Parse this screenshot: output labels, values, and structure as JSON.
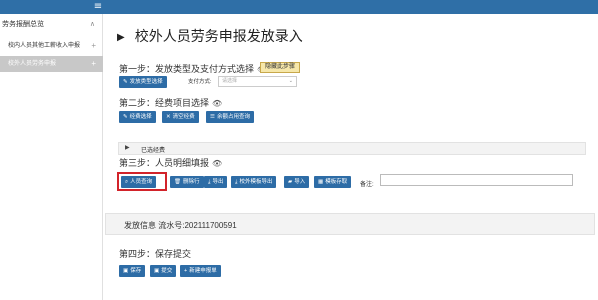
{
  "topbar": {
    "menu_icon": "hamburger-icon"
  },
  "sidebar": {
    "header": "劳务报酬总览",
    "items": [
      {
        "label": "校内人员其他工薪收入申报",
        "active": false
      },
      {
        "label": "校外人员劳务申报",
        "active": true
      }
    ]
  },
  "page": {
    "title": "校外人员劳务申报发放录入"
  },
  "step1": {
    "title": "第一步：发放类型及支付方式选择",
    "hide_label": "隐藏此步骤",
    "type_button": "发放类型选择",
    "pay_label": "支付方式:",
    "pay_placeholder": "请选择"
  },
  "step2": {
    "title": "第二步：经费项目选择",
    "buttons": [
      "经费选择",
      "清空经费",
      "余额占用查询"
    ],
    "selected_label": "已选经费"
  },
  "step3": {
    "title": "第三步：人员明细填报",
    "buttons": [
      "人员查询",
      "删除行",
      "导出",
      "校外模板导出",
      "导入",
      "模板存取"
    ],
    "remark_label": "备注:"
  },
  "info": {
    "text": "发放信息 流水号:202111700591"
  },
  "step4": {
    "title": "第四步：保存提交",
    "buttons": [
      "保存",
      "提交",
      "新建申报单"
    ]
  }
}
